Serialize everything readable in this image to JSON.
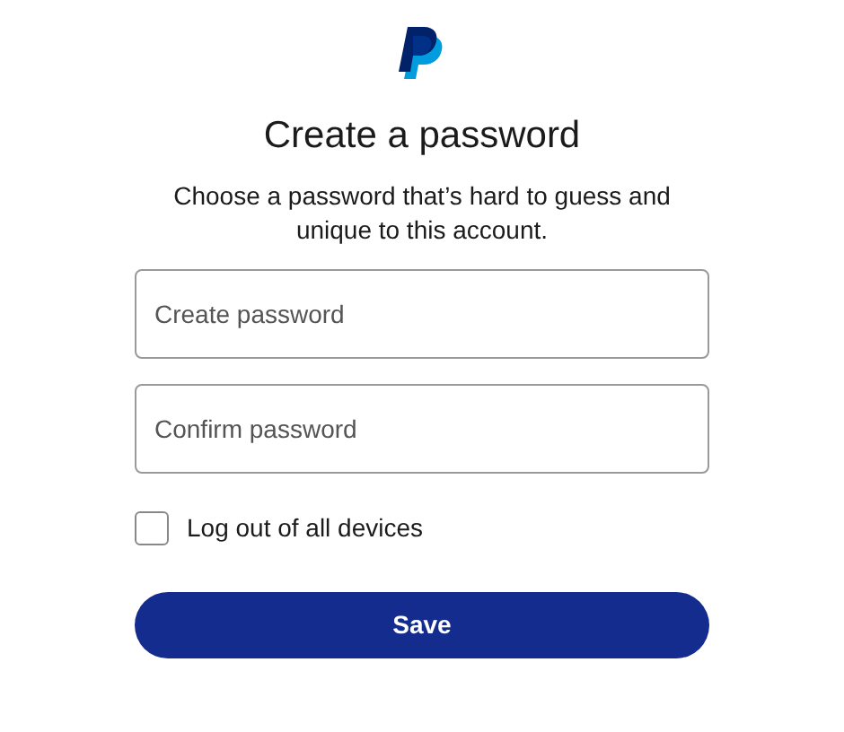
{
  "title": "Create a password",
  "description": "Choose a password that’s hard to guess and unique to this account.",
  "fields": [
    {
      "placeholder": "Create password"
    },
    {
      "placeholder": "Confirm password"
    }
  ],
  "checkbox": {
    "label": "Log out of all devices",
    "checked": false
  },
  "button": "Save"
}
